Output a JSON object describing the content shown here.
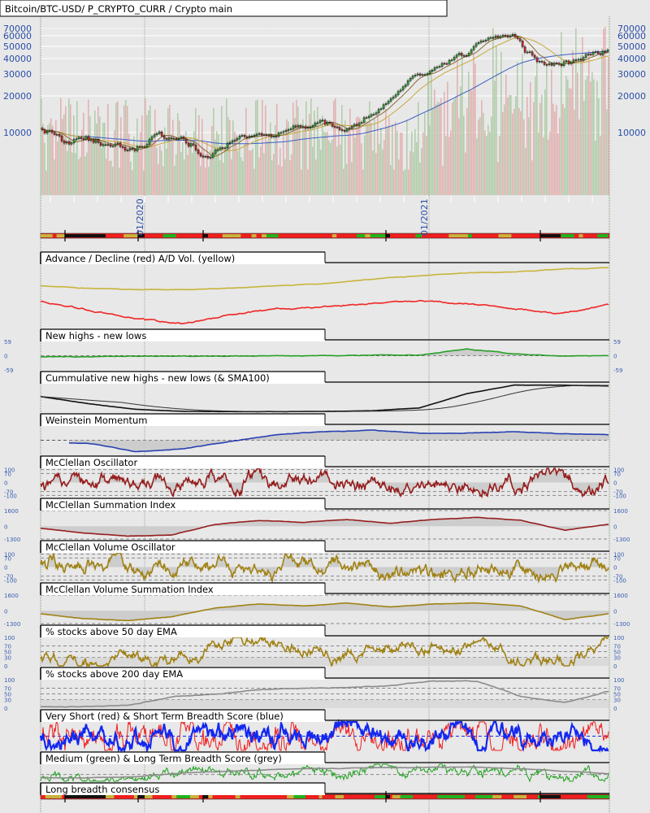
{
  "chart_data": {
    "type": "line",
    "title": "Bitcoin/BTC-USD/ P_CRYPTO_CURR / Crypto main",
    "x_range": [
      "2019-08",
      "2021-08"
    ],
    "x_tick_labels": [
      "01/2020",
      "01/2021"
    ],
    "price": {
      "scale": "log",
      "y_ticks": [
        70000,
        60000,
        50000,
        40000,
        30000,
        20000,
        10000
      ],
      "months": [
        "2019-08",
        "2019-09",
        "2019-10",
        "2019-11",
        "2019-12",
        "2020-01",
        "2020-02",
        "2020-03",
        "2020-04",
        "2020-05",
        "2020-06",
        "2020-07",
        "2020-08",
        "2020-09",
        "2020-10",
        "2020-11",
        "2020-12",
        "2021-01",
        "2021-02",
        "2021-03",
        "2021-04",
        "2021-05",
        "2021-06",
        "2021-07",
        "2021-08"
      ],
      "close": [
        10500,
        8300,
        9150,
        7550,
        7200,
        9350,
        8600,
        6400,
        8600,
        9450,
        9140,
        11300,
        11650,
        10780,
        13800,
        19700,
        29000,
        33100,
        45000,
        58800,
        60000,
        37300,
        35000,
        41500,
        46000
      ],
      "overlays": [
        "SMA200 (blue)",
        "SMA50 (gold)",
        "SMA20 (brown)"
      ]
    },
    "panels": [
      {
        "id": "ad",
        "title": "Advance / Decline (red) A/D Vol. (yellow)",
        "ylim": [
          0,
          100
        ],
        "ticks": [],
        "series": [
          {
            "name": "A/D Vol.",
            "color": "#c8b43c",
            "keys": [
              66,
              62,
              60,
              60,
              62,
              66,
              70,
              76,
              82,
              86,
              88,
              92,
              94
            ],
            "noise": 1.2
          },
          {
            "name": "Advance / Decline",
            "color": "#f02828",
            "keys": [
              42,
              28,
              14,
              6,
              20,
              30,
              32,
              38,
              42,
              38,
              30,
              22,
              36
            ],
            "noise": 3
          }
        ]
      },
      {
        "id": "nhnl",
        "title": "New highs - new lows",
        "ylim": [
          -59,
          59
        ],
        "ticks": [
          59,
          0,
          -59
        ],
        "zero": true,
        "series": [
          {
            "name": "New highs - new lows",
            "color": "#28a028",
            "keys": [
              -5,
              -4,
              -3,
              -2,
              -2,
              0,
              0,
              2,
              3,
              28,
              8,
              -2,
              0
            ],
            "noise": 3,
            "fill": true
          }
        ]
      },
      {
        "id": "cum",
        "title": "Cummulative new highs - new lows (& SMA100)",
        "ylim": [
          0,
          100
        ],
        "ticks": [],
        "series": [
          {
            "name": "Cumulative",
            "color": "#111111",
            "keys": [
              55,
              30,
              10,
              3,
              2,
              2,
              3,
              5,
              15,
              65,
              95,
              95,
              92
            ],
            "noise": 0.6,
            "sma": 100,
            "smaColor": "#333333"
          }
        ]
      },
      {
        "id": "wm",
        "title": "Weinstein Momentum",
        "ylim": [
          -100,
          100
        ],
        "ticks": [],
        "zero": true,
        "start": 0.05,
        "series": [
          {
            "name": "Weinstein Momentum",
            "color": "#2840b0",
            "keys": [
              -20,
              -20,
              -80,
              -60,
              -10,
              40,
              60,
              70,
              50,
              50,
              60,
              45,
              40
            ],
            "noise": 4,
            "fill": true
          }
        ]
      },
      {
        "id": "mco",
        "title": "McClellan Oscillator",
        "ylim": [
          -110,
          110
        ],
        "ticks": [
          100,
          70,
          0,
          -70,
          -100
        ],
        "zero": true,
        "dash": [
          70,
          -70,
          100,
          -100
        ],
        "series": [
          {
            "name": "McClellan Oscillator",
            "color": "#961e1e",
            "keys": [
              0,
              0,
              0,
              0,
              0,
              0,
              0,
              0,
              0,
              0,
              0,
              0,
              0
            ],
            "osc": 55,
            "fill": true
          }
        ]
      },
      {
        "id": "msi",
        "title": "McClellan Summation Index",
        "ylim": [
          -1300,
          1600
        ],
        "ticks": [
          1600,
          0,
          -1300
        ],
        "zero": true,
        "dash": [
          1600,
          -1300
        ],
        "series": [
          {
            "name": "McClellan Summation Index",
            "color": "#961e1e",
            "keys": [
              -200,
              -700,
              -1000,
              -900,
              200,
              600,
              400,
              700,
              300,
              700,
              900,
              600,
              -400,
              200
            ],
            "noise": 40,
            "fill": true
          }
        ]
      },
      {
        "id": "mvo",
        "title": "McClellan Volume Oscillator",
        "ylim": [
          -110,
          110
        ],
        "ticks": [
          100,
          70,
          0,
          -70,
          -100
        ],
        "zero": true,
        "dash": [
          70,
          -70,
          100,
          -100
        ],
        "series": [
          {
            "name": "McClellan Volume Oscillator",
            "color": "#a08214",
            "keys": [
              0,
              0,
              0,
              0,
              0,
              0,
              0,
              0,
              0,
              0,
              0,
              0,
              0
            ],
            "osc": 60,
            "fill": true
          }
        ]
      },
      {
        "id": "mvsi",
        "title": "McClellan Volume Summation Index",
        "ylim": [
          -1300,
          1600
        ],
        "ticks": [
          1600,
          0,
          -1300
        ],
        "zero": true,
        "dash": [
          1600,
          -1300
        ],
        "series": [
          {
            "name": "McClellan Volume Summation Index",
            "color": "#a08214",
            "keys": [
              -300,
              -800,
              -1000,
              -600,
              300,
              700,
              500,
              800,
              400,
              700,
              800,
              500,
              -900,
              -300
            ],
            "noise": 40,
            "fill": true
          }
        ]
      },
      {
        "id": "p50",
        "title": "% stocks above 50 day EMA",
        "ylim": [
          0,
          100
        ],
        "ticks": [
          100,
          70,
          50,
          30,
          0
        ],
        "dash": [
          70,
          50,
          30
        ],
        "series": [
          {
            "name": "% above 50 day EMA",
            "color": "#a08214",
            "keys": [
              10,
              5,
              40,
              20,
              70,
              85,
              60,
              40,
              70,
              60,
              80,
              30,
              10,
              80
            ],
            "osc": 22,
            "clamp": true
          }
        ]
      },
      {
        "id": "p200",
        "title": "% stocks above 200 day EMA",
        "ylim": [
          0,
          100
        ],
        "ticks": [
          100,
          70,
          50,
          30,
          0
        ],
        "dash": [
          70,
          50,
          30
        ],
        "series": [
          {
            "name": "% above 200 day EMA",
            "color": "#8c8c8c",
            "keys": [
              5,
              5,
              10,
              40,
              50,
              65,
              70,
              72,
              80,
              95,
              95,
              40,
              20,
              60
            ],
            "noise": 3,
            "clamp": true
          }
        ]
      },
      {
        "id": "vsst",
        "title": "Very Short (red) & Short Term Breadth Score (blue)",
        "ylim": [
          0,
          100
        ],
        "ticks": [],
        "dash": [
          50
        ],
        "series": [
          {
            "name": "Very Short",
            "color": "#f01e1e",
            "keys": [
              50,
              50,
              50,
              50,
              50,
              50,
              50,
              50,
              50,
              50,
              50,
              50,
              50
            ],
            "osc": 45,
            "clamp": true,
            "thin": true
          },
          {
            "name": "Short Term",
            "color": "#1428f0",
            "keys": [
              50,
              50,
              50,
              50,
              50,
              50,
              50,
              50,
              50,
              50,
              50,
              50,
              50
            ],
            "osc": 38,
            "clamp": true,
            "thick": true
          }
        ]
      },
      {
        "id": "ml",
        "title": "Medium (green) & Long Term Breadth Score (grey)",
        "ylim": [
          0,
          100
        ],
        "ticks": [],
        "dash": [
          40
        ],
        "series": [
          {
            "name": "Medium",
            "color": "#1ea01e",
            "keys": [
              20,
              15,
              30,
              60,
              40,
              70,
              50,
              60,
              50,
              70,
              60,
              20,
              40
            ],
            "osc": 25,
            "clamp": true,
            "thin": true
          },
          {
            "name": "Long",
            "color": "#8c8c8c",
            "keys": [
              20,
              20,
              25,
              50,
              60,
              70,
              75,
              80,
              80,
              85,
              75,
              60,
              45
            ],
            "noise": 3,
            "clamp": true
          }
        ]
      }
    ],
    "consensus": {
      "title": "Long breadth consensus",
      "colors": {
        "bull": "#1eb41e",
        "bear": "#f01e1e",
        "neutral": "#c8b43c"
      }
    }
  },
  "colors": {
    "background": "#e8e8e8",
    "grid": "#ffffff",
    "axis_text": "#3a5fb0",
    "candle_up": "#28a028",
    "candle_down": "#c82828",
    "volume_up": "#a8c8a0",
    "volume_down": "#e0a8a8"
  }
}
